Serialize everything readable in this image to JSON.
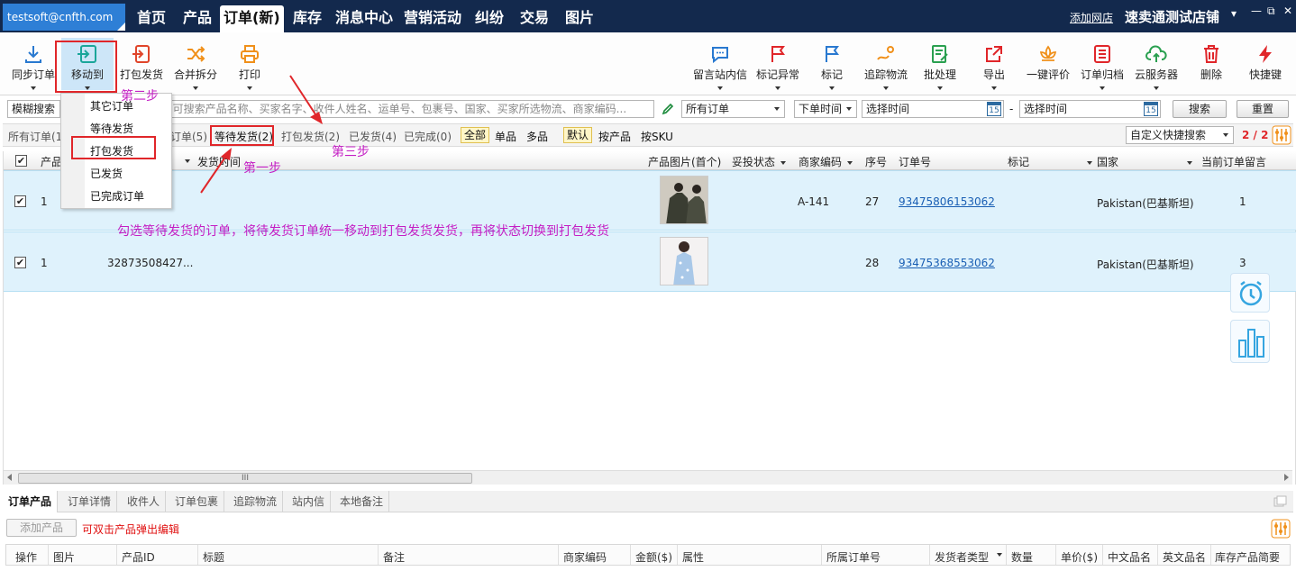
{
  "account": "testsoft@cnfth.com",
  "nav": {
    "tabs": [
      "首页",
      "产品",
      "订单(新)",
      "库存",
      "消息中心",
      "营销活动",
      "纠纷",
      "交易",
      "图片"
    ],
    "add_shop": "添加网店",
    "shop_name": "速卖通测试店铺"
  },
  "toolbar": {
    "left": [
      "同步订单",
      "移动到",
      "打包发货",
      "合并拆分",
      "打印"
    ],
    "right": [
      "留言站内信",
      "标记异常",
      "标记",
      "追踪物流",
      "批处理",
      "导出",
      "一键评价",
      "订单归档",
      "云服务器",
      "删除",
      "快捷键"
    ]
  },
  "move_menu": {
    "items": [
      "其它订单",
      "等待发货",
      "打包发货",
      "已发货",
      "已完成订单"
    ]
  },
  "search": {
    "type_label": "模糊搜索",
    "placeholder": "键字(可搜索产品名称、买家名字、收件人姓名、运单号、包裹号、国家、买家所选物流、商家编码...",
    "order_filter": "所有订单",
    "time_type": "下单时间",
    "start_time": "选择时间",
    "dash": "-",
    "end_time": "选择时间",
    "calendar_day": "15",
    "search_btn": "搜索",
    "reset_btn": "重置"
  },
  "filters": {
    "all_orders": "所有订单(1",
    "hidden_order": "订单(5)",
    "waiting": "等待发货(2)",
    "packing": "打包发货(2)",
    "shipped": "已发货(4)",
    "completed": "已完成(0)",
    "scope": [
      "全部",
      "单品",
      "多品"
    ],
    "view": [
      "默认",
      "按产品",
      "按SKU"
    ],
    "quick_search": "自定义快捷搜索",
    "page": "2 / 2"
  },
  "grid": {
    "headers": {
      "product": "产品",
      "ship_time": "发货时间",
      "image": "产品图片(首个)",
      "complaint": "妥投状态",
      "sku": "商家编码",
      "seq": "序号",
      "order_no": "订单号",
      "mark": "标记",
      "country": "国家",
      "msg": "当前订单留言"
    },
    "rows": [
      {
        "qty": "1",
        "id": "",
        "sku": "A-141",
        "seq": "27",
        "order_no": "93475806153062",
        "country": "Pakistan(巴基斯坦)",
        "msg": "1"
      },
      {
        "qty": "1",
        "id": "32873508427...",
        "sku": "",
        "seq": "28",
        "order_no": "93475368553062",
        "country": "Pakistan(巴基斯坦)",
        "msg": "3"
      }
    ]
  },
  "annotations": {
    "step1": "第一步",
    "step2": "第二步",
    "step3": "第三步",
    "instruction": "勾选等待发货的订单，将待发货订单统一移动到打包发货发货，再将状态切换到打包发货"
  },
  "bottom": {
    "tabs": [
      "订单产品",
      "订单详情",
      "收件人",
      "订单包裹",
      "追踪物流",
      "站内信",
      "本地备注"
    ],
    "add_product": "添加产品",
    "hint": "可双击产品弹出编辑",
    "headers": [
      "操作",
      "图片",
      "产品ID",
      "标题",
      "备注",
      "商家编码",
      "金额($)",
      "属性",
      "所属订单号",
      "发货者类型",
      "数量",
      "单价($)",
      "中文品名",
      "英文品名",
      "库存产品简要"
    ]
  },
  "colors": {
    "accent": "#2e7fd6",
    "highlight": "#e0262a",
    "annotation": "#c41fc4",
    "row": "#dff2fc"
  }
}
